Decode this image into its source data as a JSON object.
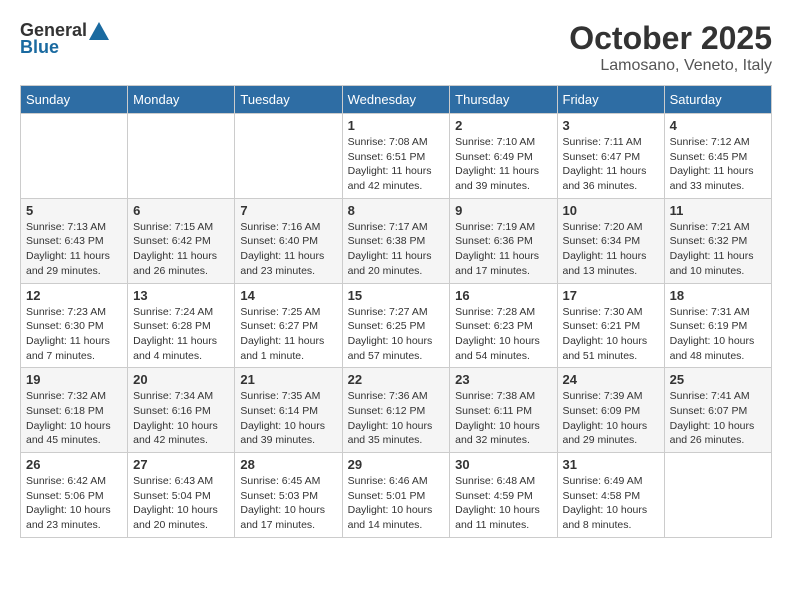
{
  "header": {
    "logo_general": "General",
    "logo_blue": "Blue",
    "title": "October 2025",
    "subtitle": "Lamosano, Veneto, Italy"
  },
  "days_of_week": [
    "Sunday",
    "Monday",
    "Tuesday",
    "Wednesday",
    "Thursday",
    "Friday",
    "Saturday"
  ],
  "weeks": [
    [
      {
        "day": "",
        "info": ""
      },
      {
        "day": "",
        "info": ""
      },
      {
        "day": "",
        "info": ""
      },
      {
        "day": "1",
        "info": "Sunrise: 7:08 AM\nSunset: 6:51 PM\nDaylight: 11 hours and 42 minutes."
      },
      {
        "day": "2",
        "info": "Sunrise: 7:10 AM\nSunset: 6:49 PM\nDaylight: 11 hours and 39 minutes."
      },
      {
        "day": "3",
        "info": "Sunrise: 7:11 AM\nSunset: 6:47 PM\nDaylight: 11 hours and 36 minutes."
      },
      {
        "day": "4",
        "info": "Sunrise: 7:12 AM\nSunset: 6:45 PM\nDaylight: 11 hours and 33 minutes."
      }
    ],
    [
      {
        "day": "5",
        "info": "Sunrise: 7:13 AM\nSunset: 6:43 PM\nDaylight: 11 hours and 29 minutes."
      },
      {
        "day": "6",
        "info": "Sunrise: 7:15 AM\nSunset: 6:42 PM\nDaylight: 11 hours and 26 minutes."
      },
      {
        "day": "7",
        "info": "Sunrise: 7:16 AM\nSunset: 6:40 PM\nDaylight: 11 hours and 23 minutes."
      },
      {
        "day": "8",
        "info": "Sunrise: 7:17 AM\nSunset: 6:38 PM\nDaylight: 11 hours and 20 minutes."
      },
      {
        "day": "9",
        "info": "Sunrise: 7:19 AM\nSunset: 6:36 PM\nDaylight: 11 hours and 17 minutes."
      },
      {
        "day": "10",
        "info": "Sunrise: 7:20 AM\nSunset: 6:34 PM\nDaylight: 11 hours and 13 minutes."
      },
      {
        "day": "11",
        "info": "Sunrise: 7:21 AM\nSunset: 6:32 PM\nDaylight: 11 hours and 10 minutes."
      }
    ],
    [
      {
        "day": "12",
        "info": "Sunrise: 7:23 AM\nSunset: 6:30 PM\nDaylight: 11 hours and 7 minutes."
      },
      {
        "day": "13",
        "info": "Sunrise: 7:24 AM\nSunset: 6:28 PM\nDaylight: 11 hours and 4 minutes."
      },
      {
        "day": "14",
        "info": "Sunrise: 7:25 AM\nSunset: 6:27 PM\nDaylight: 11 hours and 1 minute."
      },
      {
        "day": "15",
        "info": "Sunrise: 7:27 AM\nSunset: 6:25 PM\nDaylight: 10 hours and 57 minutes."
      },
      {
        "day": "16",
        "info": "Sunrise: 7:28 AM\nSunset: 6:23 PM\nDaylight: 10 hours and 54 minutes."
      },
      {
        "day": "17",
        "info": "Sunrise: 7:30 AM\nSunset: 6:21 PM\nDaylight: 10 hours and 51 minutes."
      },
      {
        "day": "18",
        "info": "Sunrise: 7:31 AM\nSunset: 6:19 PM\nDaylight: 10 hours and 48 minutes."
      }
    ],
    [
      {
        "day": "19",
        "info": "Sunrise: 7:32 AM\nSunset: 6:18 PM\nDaylight: 10 hours and 45 minutes."
      },
      {
        "day": "20",
        "info": "Sunrise: 7:34 AM\nSunset: 6:16 PM\nDaylight: 10 hours and 42 minutes."
      },
      {
        "day": "21",
        "info": "Sunrise: 7:35 AM\nSunset: 6:14 PM\nDaylight: 10 hours and 39 minutes."
      },
      {
        "day": "22",
        "info": "Sunrise: 7:36 AM\nSunset: 6:12 PM\nDaylight: 10 hours and 35 minutes."
      },
      {
        "day": "23",
        "info": "Sunrise: 7:38 AM\nSunset: 6:11 PM\nDaylight: 10 hours and 32 minutes."
      },
      {
        "day": "24",
        "info": "Sunrise: 7:39 AM\nSunset: 6:09 PM\nDaylight: 10 hours and 29 minutes."
      },
      {
        "day": "25",
        "info": "Sunrise: 7:41 AM\nSunset: 6:07 PM\nDaylight: 10 hours and 26 minutes."
      }
    ],
    [
      {
        "day": "26",
        "info": "Sunrise: 6:42 AM\nSunset: 5:06 PM\nDaylight: 10 hours and 23 minutes."
      },
      {
        "day": "27",
        "info": "Sunrise: 6:43 AM\nSunset: 5:04 PM\nDaylight: 10 hours and 20 minutes."
      },
      {
        "day": "28",
        "info": "Sunrise: 6:45 AM\nSunset: 5:03 PM\nDaylight: 10 hours and 17 minutes."
      },
      {
        "day": "29",
        "info": "Sunrise: 6:46 AM\nSunset: 5:01 PM\nDaylight: 10 hours and 14 minutes."
      },
      {
        "day": "30",
        "info": "Sunrise: 6:48 AM\nSunset: 4:59 PM\nDaylight: 10 hours and 11 minutes."
      },
      {
        "day": "31",
        "info": "Sunrise: 6:49 AM\nSunset: 4:58 PM\nDaylight: 10 hours and 8 minutes."
      },
      {
        "day": "",
        "info": ""
      }
    ]
  ]
}
